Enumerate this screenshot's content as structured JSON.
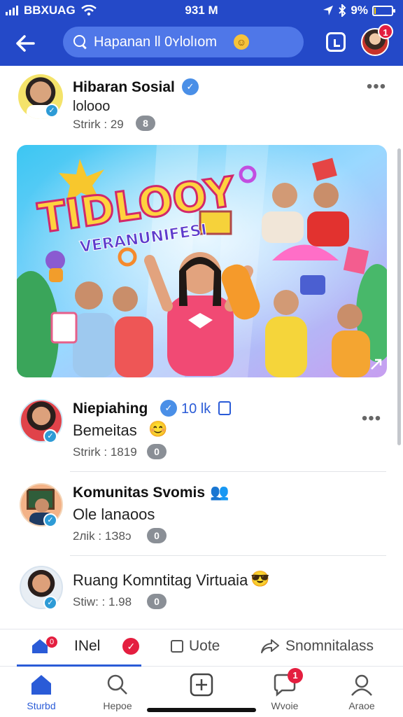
{
  "status_bar": {
    "carrier": "BBXUAG",
    "time": "931 M",
    "battery": "9%",
    "battery_level": 0.09,
    "location_icon": "location-arrow-icon",
    "bluetooth_icon": "bluetooth-icon",
    "wifi_icon": "wifi-icon"
  },
  "nav": {
    "search_value": "Hapanan ll 0ʏlolıom",
    "notification_count": "1",
    "back_icon": "arrow-left-icon",
    "brand_color": "#2449c8"
  },
  "post": {
    "title": "Hibaran Sosial",
    "subtitle": "lolooo",
    "meta": "Strirk : 29",
    "badge": "8"
  },
  "banner": {
    "headline": "TIDLOOY",
    "subline": "VERANUNIFESI"
  },
  "list": [
    {
      "title": "Niepiahing",
      "stat": "10 lk",
      "subtitle": "Bemeitas",
      "meta": "Strirk : 1819",
      "badge": "0",
      "emoji": "😊"
    },
    {
      "title": "Komunitas Svomis",
      "subtitle": "Ole lanaoos",
      "meta": "2лik : 1З8ɔ",
      "badge": "0",
      "emoji": "👥"
    },
    {
      "title": "Ruang Komntitag Virtuaia",
      "subtitle": "",
      "meta": "Stiw: : 1.98",
      "badge": "0",
      "emoji": "😎"
    }
  ],
  "actions": {
    "tab_label": "INel",
    "vote_label": "Uote",
    "share_label": "Snomnitalass",
    "tab_badge": "0"
  },
  "bottom_nav": {
    "items": [
      {
        "label": "Sturbd",
        "icon": "home-icon",
        "active": true
      },
      {
        "label": "Hepoe",
        "icon": "search-icon",
        "active": false
      },
      {
        "label": "",
        "icon": "plus-square-icon",
        "active": false
      },
      {
        "label": "Wvoie",
        "icon": "chat-icon",
        "active": false,
        "badge": "1"
      },
      {
        "label": "Araoe",
        "icon": "profile-icon",
        "active": false
      }
    ],
    "accent_color": "#2a5bd7"
  }
}
